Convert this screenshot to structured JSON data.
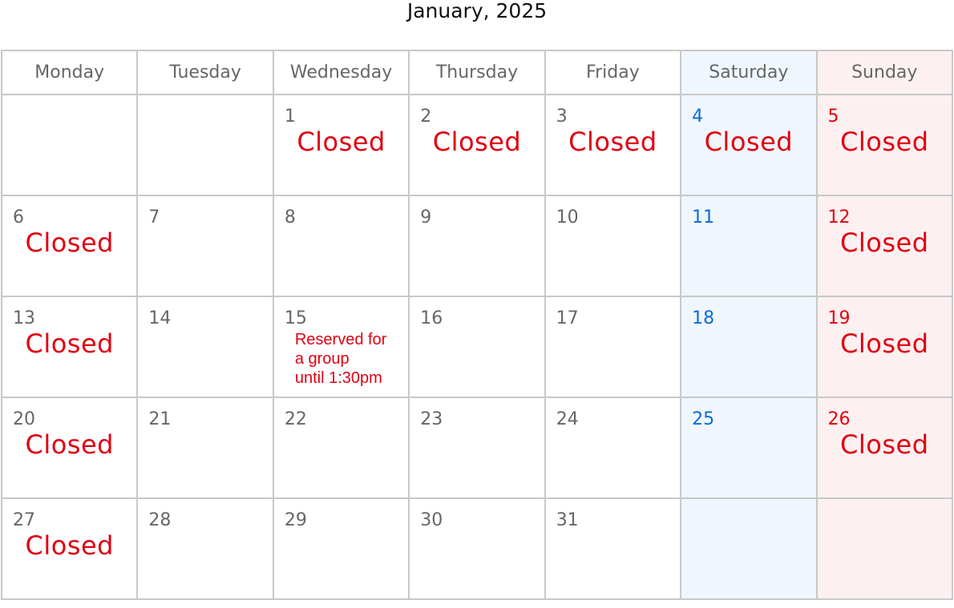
{
  "title": "January, 2025",
  "colors": {
    "grid": "#c8c8c8",
    "weekday_text": "#666666",
    "saturday_text": "#0a6ad8",
    "sunday_text": "#e00010",
    "saturday_bg": "#eff6fe",
    "sunday_bg": "#fdf0f1",
    "note_text": "#e00010"
  },
  "weekdays": [
    "Monday",
    "Tuesday",
    "Wednesday",
    "Thursday",
    "Friday",
    "Saturday",
    "Sunday"
  ],
  "weeks": [
    [
      {
        "day": "",
        "note": ""
      },
      {
        "day": "",
        "note": ""
      },
      {
        "day": "1",
        "note": "Closed"
      },
      {
        "day": "2",
        "note": "Closed"
      },
      {
        "day": "3",
        "note": "Closed"
      },
      {
        "day": "4",
        "note": "Closed"
      },
      {
        "day": "5",
        "note": "Closed"
      }
    ],
    [
      {
        "day": "6",
        "note": "Closed"
      },
      {
        "day": "7",
        "note": ""
      },
      {
        "day": "8",
        "note": ""
      },
      {
        "day": "9",
        "note": ""
      },
      {
        "day": "10",
        "note": ""
      },
      {
        "day": "11",
        "note": ""
      },
      {
        "day": "12",
        "note": "Closed"
      }
    ],
    [
      {
        "day": "13",
        "note": "Closed"
      },
      {
        "day": "14",
        "note": ""
      },
      {
        "day": "15",
        "note": "",
        "detail_lines": [
          "Reserved for",
          "a group",
          "until 1:30pm"
        ]
      },
      {
        "day": "16",
        "note": ""
      },
      {
        "day": "17",
        "note": ""
      },
      {
        "day": "18",
        "note": ""
      },
      {
        "day": "19",
        "note": "Closed"
      }
    ],
    [
      {
        "day": "20",
        "note": "Closed"
      },
      {
        "day": "21",
        "note": ""
      },
      {
        "day": "22",
        "note": ""
      },
      {
        "day": "23",
        "note": ""
      },
      {
        "day": "24",
        "note": ""
      },
      {
        "day": "25",
        "note": ""
      },
      {
        "day": "26",
        "note": "Closed"
      }
    ],
    [
      {
        "day": "27",
        "note": "Closed"
      },
      {
        "day": "28",
        "note": ""
      },
      {
        "day": "29",
        "note": ""
      },
      {
        "day": "30",
        "note": ""
      },
      {
        "day": "31",
        "note": ""
      },
      {
        "day": "",
        "note": ""
      },
      {
        "day": "",
        "note": ""
      }
    ]
  ]
}
